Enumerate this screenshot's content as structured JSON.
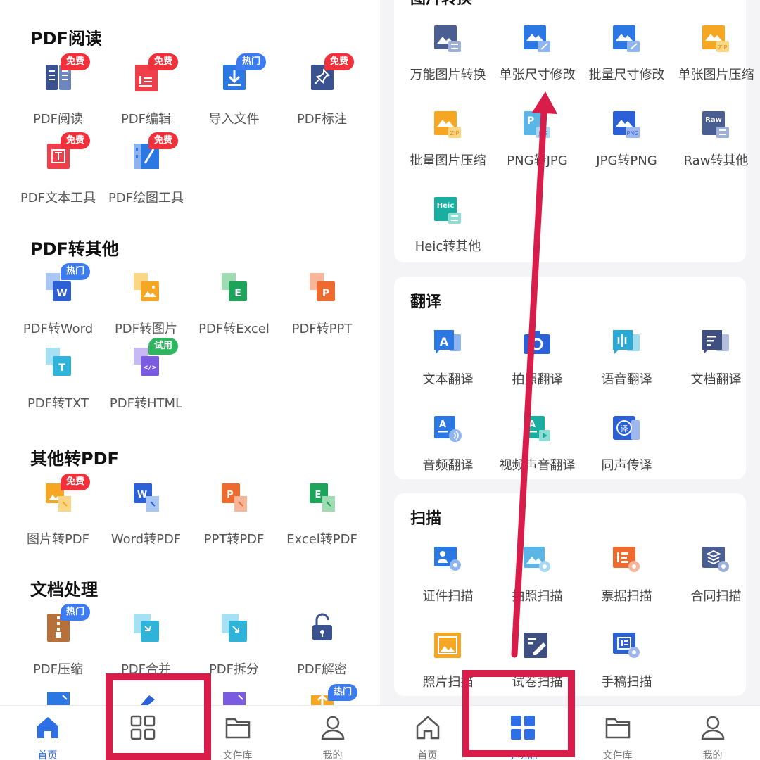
{
  "left": {
    "sections": [
      {
        "title": "PDF阅读",
        "items": [
          {
            "label": "PDF阅读",
            "icon": "book-icon",
            "badge": "免费",
            "badge_color": "red"
          },
          {
            "label": "PDF编辑",
            "icon": "pdf-edit-icon",
            "badge": "免费",
            "badge_color": "red"
          },
          {
            "label": "导入文件",
            "icon": "import-icon",
            "badge": "热门",
            "badge_color": "blue"
          },
          {
            "label": "PDF标注",
            "icon": "pin-icon",
            "badge": "免费",
            "badge_color": "red"
          },
          {
            "label": "PDF文本工具",
            "icon": "text-tool-icon",
            "badge": "免费",
            "badge_color": "red"
          },
          {
            "label": "PDF绘图工具",
            "icon": "draw-tool-icon",
            "badge": "免费",
            "badge_color": "red"
          }
        ]
      },
      {
        "title": "PDF转其他",
        "items": [
          {
            "label": "PDF转Word",
            "icon": "pdf-to-word-icon",
            "badge": "热门",
            "badge_color": "blue"
          },
          {
            "label": "PDF转图片",
            "icon": "pdf-to-image-icon"
          },
          {
            "label": "PDF转Excel",
            "icon": "pdf-to-excel-icon"
          },
          {
            "label": "PDF转PPT",
            "icon": "pdf-to-ppt-icon"
          },
          {
            "label": "PDF转TXT",
            "icon": "pdf-to-txt-icon"
          },
          {
            "label": "PDF转HTML",
            "icon": "pdf-to-html-icon",
            "badge": "试用",
            "badge_color": "green"
          }
        ]
      },
      {
        "title": "其他转PDF",
        "items": [
          {
            "label": "图片转PDF",
            "icon": "image-to-pdf-icon",
            "badge": "免费",
            "badge_color": "red"
          },
          {
            "label": "Word转PDF",
            "icon": "word-to-pdf-icon"
          },
          {
            "label": "PPT转PDF",
            "icon": "ppt-to-pdf-icon"
          },
          {
            "label": "Excel转PDF",
            "icon": "excel-to-pdf-icon"
          }
        ]
      },
      {
        "title": "文档处理",
        "items": [
          {
            "label": "PDF压缩",
            "icon": "zip-icon",
            "badge": "热门",
            "badge_color": "blue"
          },
          {
            "label": "PDF合并",
            "icon": "merge-icon"
          },
          {
            "label": "PDF拆分",
            "icon": "split-icon"
          },
          {
            "label": "PDF解密",
            "icon": "unlock-icon"
          }
        ]
      }
    ],
    "partial_row_badge": "热门",
    "tabs": [
      {
        "label": "首页",
        "icon": "home-icon"
      },
      {
        "label": "",
        "icon": "grid-icon"
      },
      {
        "label": "文件库",
        "icon": "folder-icon"
      },
      {
        "label": "我的",
        "icon": "user-icon"
      }
    ]
  },
  "right": {
    "cards": [
      {
        "title": "图片转换",
        "items": [
          {
            "label": "万能图片转换",
            "icon": "image-convert-icon"
          },
          {
            "label": "单张尺寸修改",
            "icon": "image-resize-icon"
          },
          {
            "label": "批量尺寸修改",
            "icon": "batch-resize-icon"
          },
          {
            "label": "单张图片压缩",
            "icon": "image-zip-icon"
          },
          {
            "label": "批量图片压缩",
            "icon": "batch-zip-icon"
          },
          {
            "label": "PNG转JPG",
            "icon": "png-jpg-icon"
          },
          {
            "label": "JPG转PNG",
            "icon": "jpg-png-icon"
          },
          {
            "label": "Raw转其他",
            "icon": "raw-icon"
          },
          {
            "label": "Heic转其他",
            "icon": "heic-icon"
          }
        ]
      },
      {
        "title": "翻译",
        "items": [
          {
            "label": "文本翻译",
            "icon": "text-translate-icon"
          },
          {
            "label": "拍照翻译",
            "icon": "camera-translate-icon"
          },
          {
            "label": "语音翻译",
            "icon": "voice-translate-icon"
          },
          {
            "label": "文档翻译",
            "icon": "doc-translate-icon"
          },
          {
            "label": "音频翻译",
            "icon": "audio-translate-icon"
          },
          {
            "label": "视频声音翻译",
            "icon": "video-translate-icon"
          },
          {
            "label": "同声传译",
            "icon": "simul-translate-icon"
          }
        ]
      },
      {
        "title": "扫描",
        "items": [
          {
            "label": "证件扫描",
            "icon": "id-scan-icon"
          },
          {
            "label": "拍照扫描",
            "icon": "photo-scan-icon"
          },
          {
            "label": "票据扫描",
            "icon": "receipt-scan-icon"
          },
          {
            "label": "合同扫描",
            "icon": "contract-scan-icon"
          },
          {
            "label": "照片扫描",
            "icon": "picture-scan-icon"
          },
          {
            "label": "试卷扫描",
            "icon": "exam-scan-icon"
          },
          {
            "label": "手稿扫描",
            "icon": "manuscript-scan-icon"
          }
        ]
      }
    ],
    "tabs": [
      {
        "label": "首页",
        "icon": "home-icon"
      },
      {
        "label": "小功能",
        "icon": "grid-icon"
      },
      {
        "label": "文件库",
        "icon": "folder-icon"
      },
      {
        "label": "我的",
        "icon": "user-icon"
      }
    ]
  },
  "colors": {
    "accent": "#2e6fe6",
    "highlight": "#d81d4b"
  }
}
